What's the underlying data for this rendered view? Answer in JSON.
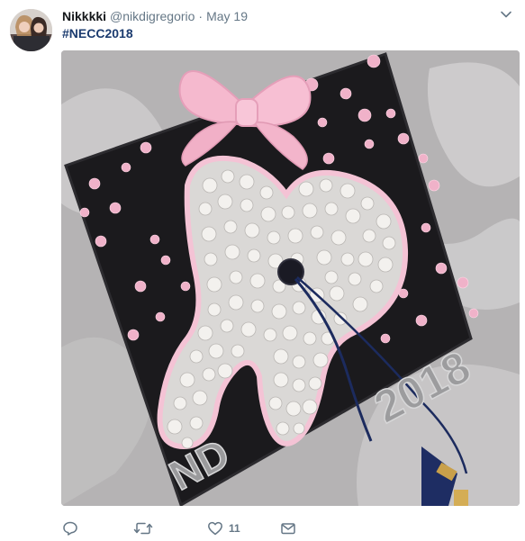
{
  "tweet": {
    "author_name": "Nikkkki",
    "author_handle": "@nikdigregorio",
    "separator": "·",
    "timestamp": "May 19",
    "text_hashtag": "#NECC2018",
    "media": {
      "cap_text_left": "ND",
      "cap_text_right": "2018"
    },
    "actions": {
      "reply_count": "",
      "retweet_count": "",
      "like_count": "11"
    }
  },
  "icons": {
    "reply": "reply-icon",
    "retweet": "retweet-icon",
    "like": "heart-icon",
    "message": "envelope-icon",
    "menu": "chevron-down-icon"
  },
  "colors": {
    "hashtag": "#1b3b6f",
    "secondary_text": "#657786",
    "cap_pink": "#f2b6cc"
  }
}
